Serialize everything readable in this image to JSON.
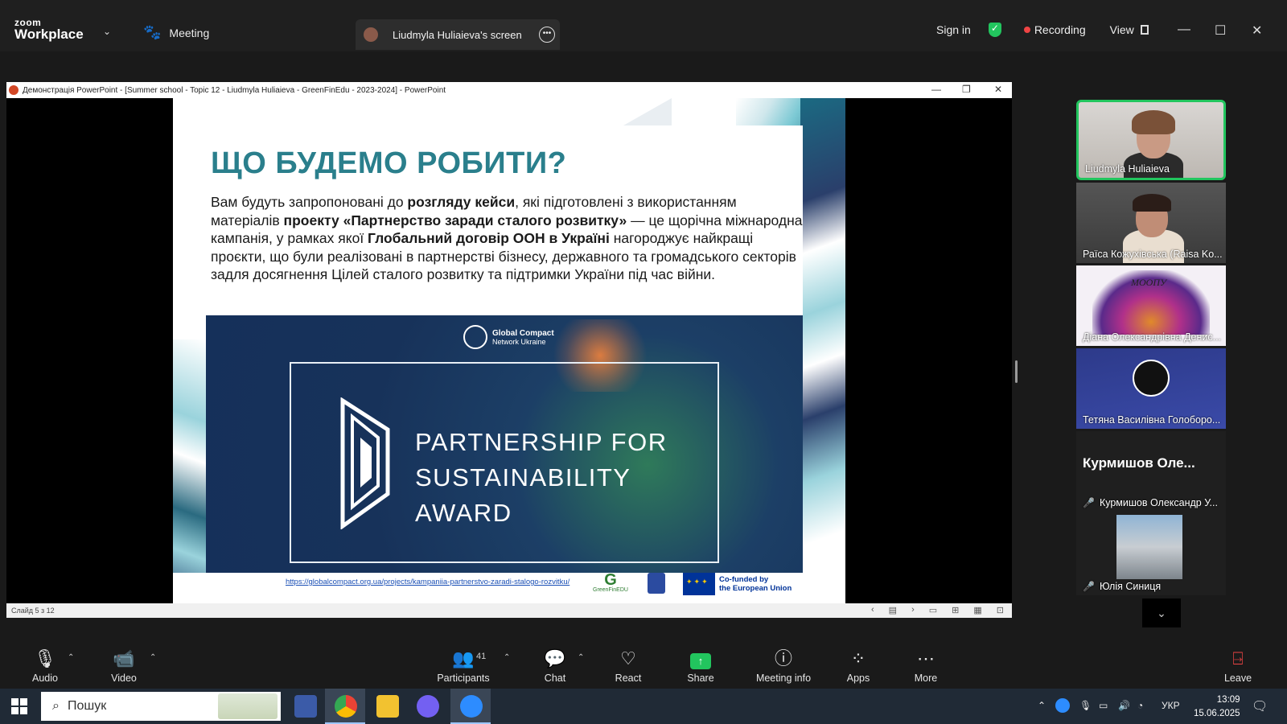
{
  "app": {
    "logo_top": "zoom",
    "logo_bottom": "Workplace",
    "meeting_label": "Meeting",
    "screen_tab_label": "Liudmyla Huliaieva's screen",
    "sign_in": "Sign in",
    "recording": "Recording",
    "view": "View"
  },
  "ppt": {
    "title": "Демонстрація PowerPoint - [Summer school - Topic 12 - Liudmyla Huliaieva - GreenFinEdu - 2023-2024] - PowerPoint",
    "status": "Слайд 5 з 12"
  },
  "slide": {
    "title": "ЩО БУДЕМО РОБИТИ?",
    "body": [
      {
        "t": "Вам будуть запропоновані до ",
        "b": false
      },
      {
        "t": "розгляду кейси",
        "b": true
      },
      {
        "t": ", які підготовлені з використанням матеріалів ",
        "b": false
      },
      {
        "t": "проекту «Партнерство заради сталого розвитку»",
        "b": true
      },
      {
        "t": " — це щорічна міжнародна кампанія, у рамках якої ",
        "b": false
      },
      {
        "t": "Глобальний договір ООН в Україні",
        "b": true
      },
      {
        "t": " нагороджує найкращі проєкти, що були реалізовані в партнерстві бізнесу, державного та громадського секторів задля досягнення Цілей сталого розвитку та підтримки України під час війни.",
        "b": false
      }
    ],
    "gc_line1": "Global Compact",
    "gc_line2": "Network Ukraine",
    "award_line1": "PARTNERSHIP FOR",
    "award_line2": "SUSTAINABILITY",
    "award_line3": "AWARD",
    "link": "https://globalcompact.org.ua/projects/kampaniia-partnerstvo-zaradi-stalogo-rozvitku/",
    "greenfin": "GreenFinEDU",
    "eu_line1": "Co-funded by",
    "eu_line2": "the European Union"
  },
  "participants": [
    {
      "name": "Liudmyla Huliaieva",
      "active": true
    },
    {
      "name": "Раїса Кожухівська (Raisa Ko...",
      "active": false
    },
    {
      "name": "Діана Олександрівна Денис...",
      "active": false,
      "logo_text": "МООПУ"
    },
    {
      "name": "Тетяна Василівна Голоборо...",
      "active": false
    },
    {
      "name": "Курмишов Олександр У...",
      "big_name": "Курмишов Оле...",
      "muted": true
    },
    {
      "name": "Юлія Синиця",
      "muted": true
    }
  ],
  "toolbar": {
    "audio": "Audio",
    "video": "Video",
    "participants": "Participants",
    "participants_count": "41",
    "chat": "Chat",
    "react": "React",
    "share": "Share",
    "meeting_info": "Meeting info",
    "apps": "Apps",
    "more": "More",
    "leave": "Leave"
  },
  "taskbar": {
    "search": "Пошук",
    "lang": "УКР",
    "time": "13:09",
    "date": "15.06.2025"
  },
  "colors": {
    "accent_green": "#22c55e",
    "record_red": "#ef4444",
    "slide_title": "#2a7f8c",
    "banner_blue": "#17325a"
  }
}
